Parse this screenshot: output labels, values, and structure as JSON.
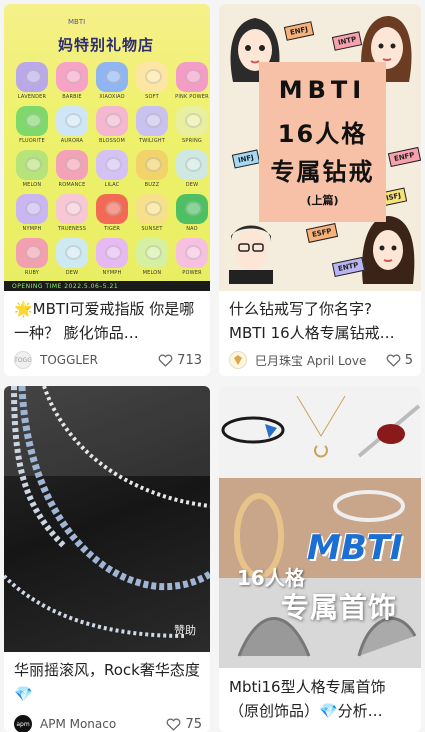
{
  "cards": [
    {
      "title": "🌟MBTI可爱戒指版 你是哪一种？ 膨化饰品…",
      "author": "TOGGLER",
      "avatar_text": "TOGG",
      "likes": "713",
      "cover": {
        "heading": "妈特别礼物店",
        "top_text": "MBTI",
        "bottom_text": "OPENING TIME 2022.5.06–5.21",
        "ring_labels": [
          "LAVENDER",
          "BARBIE",
          "XIAOXIAO",
          "SOFT",
          "PINK POWER",
          "FLUORITE",
          "AURORA",
          "BLOSSOM",
          "TWILIGHT",
          "SPRING",
          "MELON",
          "ROMANCE",
          "LILAC",
          "BUZZ",
          "DEW",
          "NYMPH",
          "TRUENESS",
          "TIGER",
          "SUNSET",
          "NAO",
          "RUBY",
          "DEW",
          "NYMPH",
          "MELON",
          "POWER"
        ]
      }
    },
    {
      "title": "什么钻戒写了你名字? MBTI 16人格专属钻戒…",
      "author": "巳月珠宝 April Love",
      "likes": "5",
      "cover": {
        "line1": "MBTI",
        "line2": "16人格",
        "line3": "专属钻戒",
        "line4": "(上篇)",
        "tags": [
          "ENFJ",
          "INTP",
          "INFJ",
          "ESFP",
          "ENTP",
          "ENFP",
          "ISFJ"
        ]
      }
    },
    {
      "title": "华丽摇滚风，Rock奢华态度💎",
      "author": "APM Monaco",
      "avatar_text": "apm",
      "likes": "75",
      "cover": {
        "badge": "赞助"
      }
    },
    {
      "title": "Mbti16型人格专属首饰（原创饰品）💎分析…",
      "cover": {
        "brand_text": "MBTI",
        "line1": "16人格",
        "line2": "专属首饰"
      }
    }
  ],
  "colors": {
    "card_bg": "#ffffff",
    "page_bg": "#f5f5f5",
    "mbti_blue": "#1b6ed2",
    "peach": "#f6c1a7"
  },
  "icons": {
    "likes": "heart-outline-icon"
  }
}
